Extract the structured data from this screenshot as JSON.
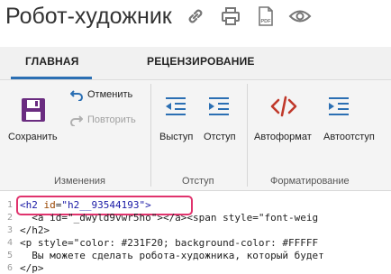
{
  "app": {
    "title": "Робот-художник"
  },
  "title_icons": [
    "link-icon",
    "print-icon",
    "pdf-icon",
    "eye-icon"
  ],
  "pdf_icon_label": "PDF",
  "tabs": [
    {
      "label": "ГЛАВНАЯ",
      "active": true
    },
    {
      "label": "РЕЦЕНЗИРОВАНИЕ",
      "active": false
    }
  ],
  "ribbon": {
    "save": "Сохранить",
    "undo": "Отменить",
    "redo": "Повторить",
    "outdent": "Выступ",
    "indent": "Отступ",
    "autoformat": "Автоформат",
    "autoindent": "Автоотступ",
    "groups": [
      "Изменения",
      "Отступ",
      "Форматирование"
    ]
  },
  "code": {
    "lines": [
      {
        "num": "1",
        "text": "<h2 id=\"h2__93544193\">"
      },
      {
        "num": "2",
        "text": "  <a id=\"_dwyld9vwr5ho\"></a><span style=\"font-weig"
      },
      {
        "num": "3",
        "text": "</h2>"
      },
      {
        "num": "4",
        "text": "<p style=\"color: #231F20; background-color: #FFFFF"
      },
      {
        "num": "5",
        "text": "  Вы можете сделать робота-художника, который будет"
      },
      {
        "num": "6",
        "text": "</p>"
      }
    ]
  },
  "colors": {
    "accent": "#2b6fb3",
    "highlight": "#e0336d",
    "autoformat": "#c0392b",
    "save": "#6a2c80"
  }
}
